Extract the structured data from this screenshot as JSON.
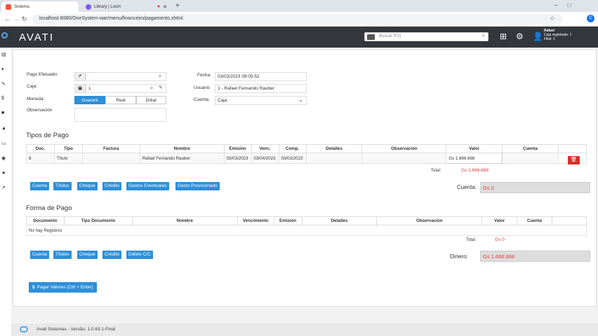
{
  "browser": {
    "tabs": [
      {
        "label": "Sistema",
        "active": true
      },
      {
        "label": "Library | Loom",
        "active": false
      }
    ],
    "url": "localhost:8080/OneSystem-war/menu/financeiro/pagamento.xhtml"
  },
  "header": {
    "logo": "AVATI",
    "search_placeholder": "Buscar (F2)",
    "user_name": "Rafael",
    "user_caja": "Caja registrado: 1",
    "user_filial": "Filial: 1"
  },
  "form": {
    "pago_efetuado_label": "Pago Efetuado:",
    "pago_efetuado_value": "",
    "caja_label": "Caja:",
    "caja_value": "1",
    "moneda_label": "Moneda:",
    "moneda_options": [
      "Guaraní",
      "Real",
      "Dólar"
    ],
    "moneda_selected": "Guaraní",
    "observacion_label": "Observación",
    "fecha_label": "Fecha:",
    "fecha_value": "03/03/2023 09:05:52",
    "usuario_label": "Usuario:",
    "usuario_value": "1 - Rafael Fernando Rauber",
    "cuenta_label": "Cuenta:",
    "cuenta_value": "Caja"
  },
  "tipos_pago": {
    "title": "Tipos de Pago",
    "columns": [
      "Doc.",
      "Tipo",
      "Factura",
      "Nombre",
      "Emisión",
      "Venc.",
      "Comp.",
      "Detalles",
      "Observación",
      "Valor",
      "Cuenta"
    ],
    "rows": [
      [
        "8",
        "Título",
        "",
        "Rafael Fernando Rauber",
        "03/03/2023",
        "03/04/2023",
        "03/03/2023",
        "",
        "",
        "Gs 1.666.668",
        ""
      ]
    ],
    "total_label": "Total:",
    "total_value": "Gs 1.666.668",
    "buttons": [
      "Cuenta",
      "Títulos",
      "Cheque",
      "Crédito",
      "Gastos Eventuales",
      "Gasto Provicionado"
    ],
    "cuenta_label": "Cuenta:",
    "cuenta_value": "Gs 0"
  },
  "forma_pago": {
    "title": "Forma de Pago",
    "columns": [
      "Documento",
      "Tipo Documento",
      "Nombre",
      "Vencimiento",
      "Emisión",
      "Detalles",
      "Observación",
      "Valor",
      "Cuenta"
    ],
    "empty_text": "No hay Registros",
    "total_label": "Total:",
    "total_value": "Gs 0",
    "buttons": [
      "Cuenta",
      "Títulos",
      "Cheque",
      "Crédito",
      "Débito C/C"
    ],
    "dinero_label": "Dinero:",
    "dinero_value": "Gs 1.666.668"
  },
  "pagar_button": "Pagar Valores (Ctrl + Enter)",
  "footer": "Avati Sistemas - Versão: 1.0.63.1-Final",
  "colors": {
    "primary": "#2f8fd8",
    "danger": "#d9302c",
    "header": "#33363b"
  }
}
